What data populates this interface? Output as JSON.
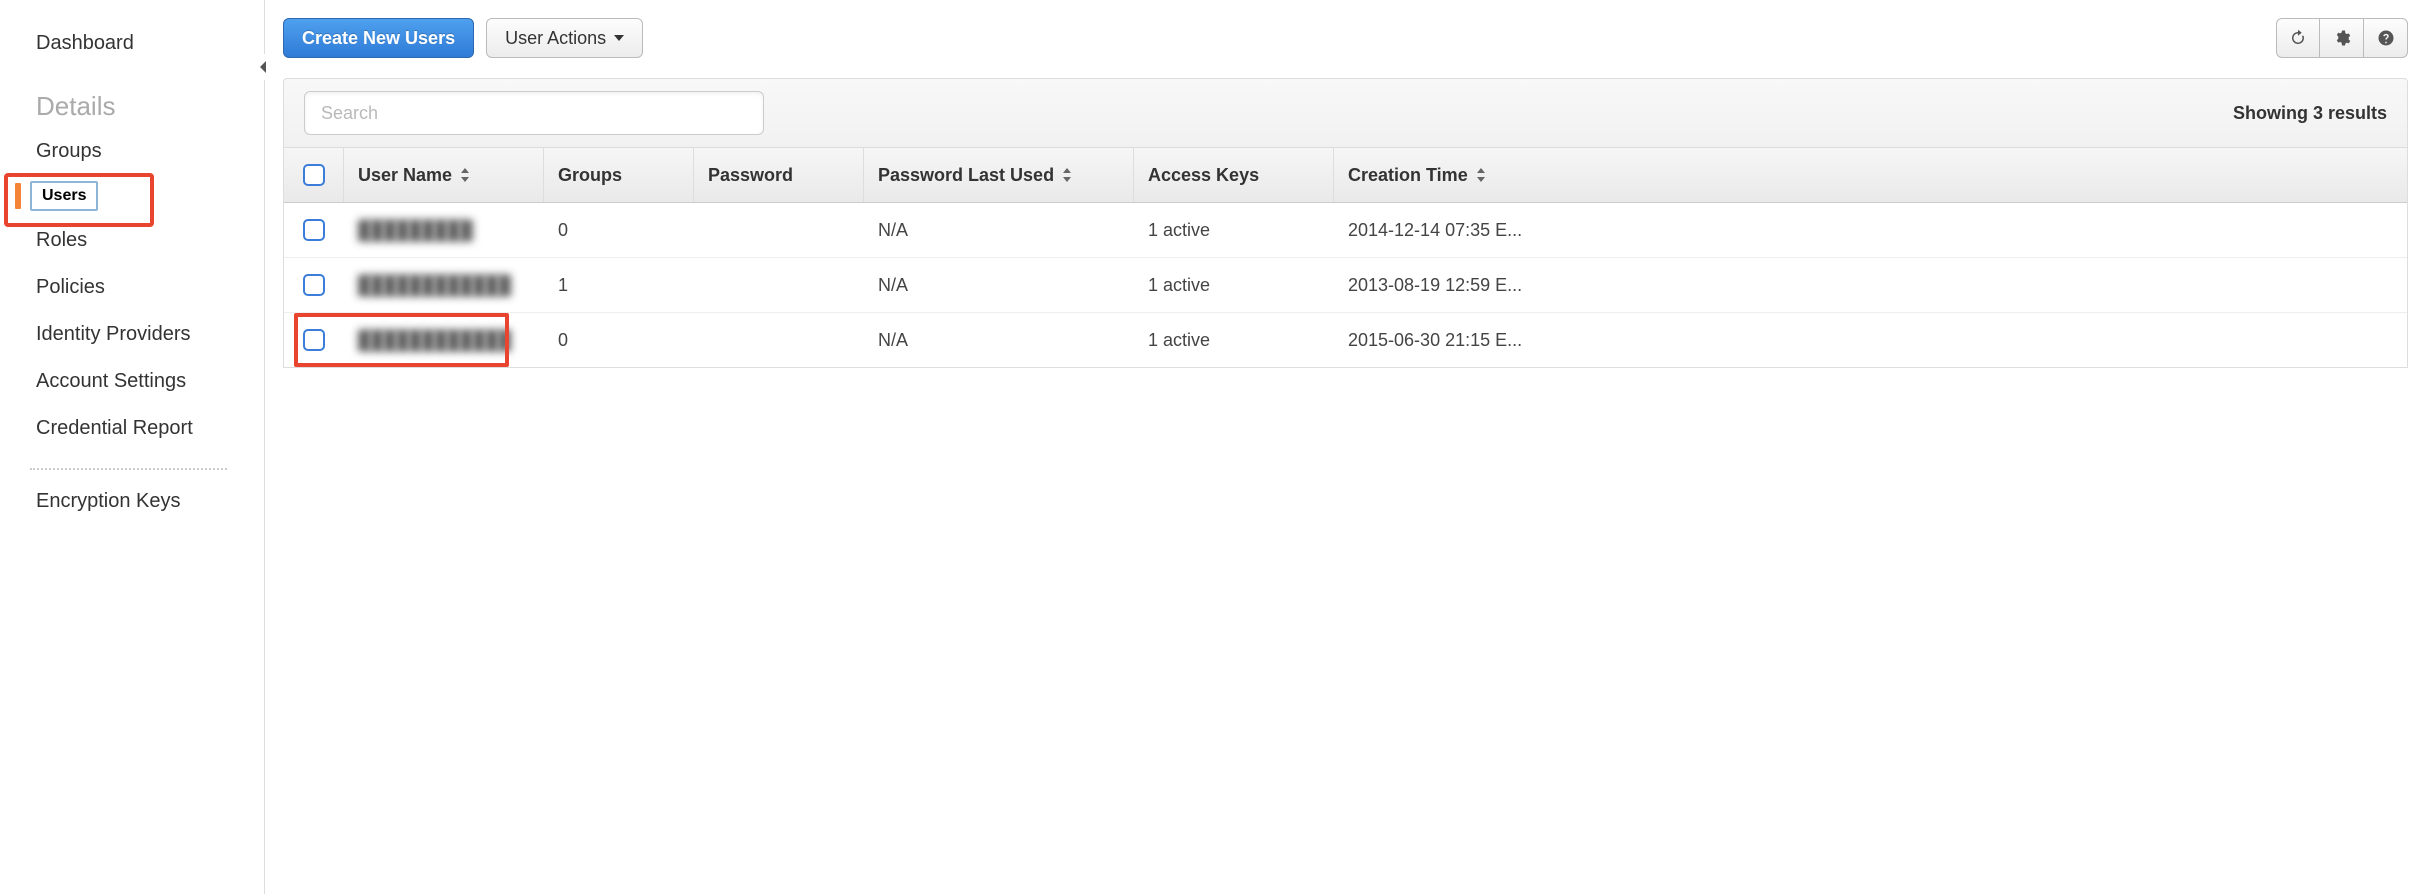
{
  "sidebar": {
    "dashboard": "Dashboard",
    "details_header": "Details",
    "items": {
      "groups": "Groups",
      "users": "Users",
      "roles": "Roles",
      "policies": "Policies",
      "identity_providers": "Identity Providers",
      "account_settings": "Account Settings",
      "credential_report": "Credential Report",
      "encryption_keys": "Encryption Keys"
    },
    "active_item": "users"
  },
  "toolbar": {
    "create_label": "Create New Users",
    "actions_label": "User Actions"
  },
  "search": {
    "placeholder": "Search"
  },
  "results_text": "Showing 3 results",
  "columns": {
    "user_name": "User Name",
    "groups": "Groups",
    "password": "Password",
    "password_last_used": "Password Last Used",
    "access_keys": "Access Keys",
    "creation_time": "Creation Time"
  },
  "rows": [
    {
      "user": "█████████",
      "groups": "0",
      "password": "",
      "password_last_used": "N/A",
      "access_keys": "1 active",
      "creation_time": "2014-12-14 07:35 E..."
    },
    {
      "user": "████████████",
      "groups": "1",
      "password": "",
      "password_last_used": "N/A",
      "access_keys": "1 active",
      "creation_time": "2013-08-19 12:59 E..."
    },
    {
      "user": "████████████",
      "groups": "0",
      "password": "",
      "password_last_used": "N/A",
      "access_keys": "1 active",
      "creation_time": "2015-06-30 21:15 E..."
    }
  ],
  "highlighted_row_index": 2
}
